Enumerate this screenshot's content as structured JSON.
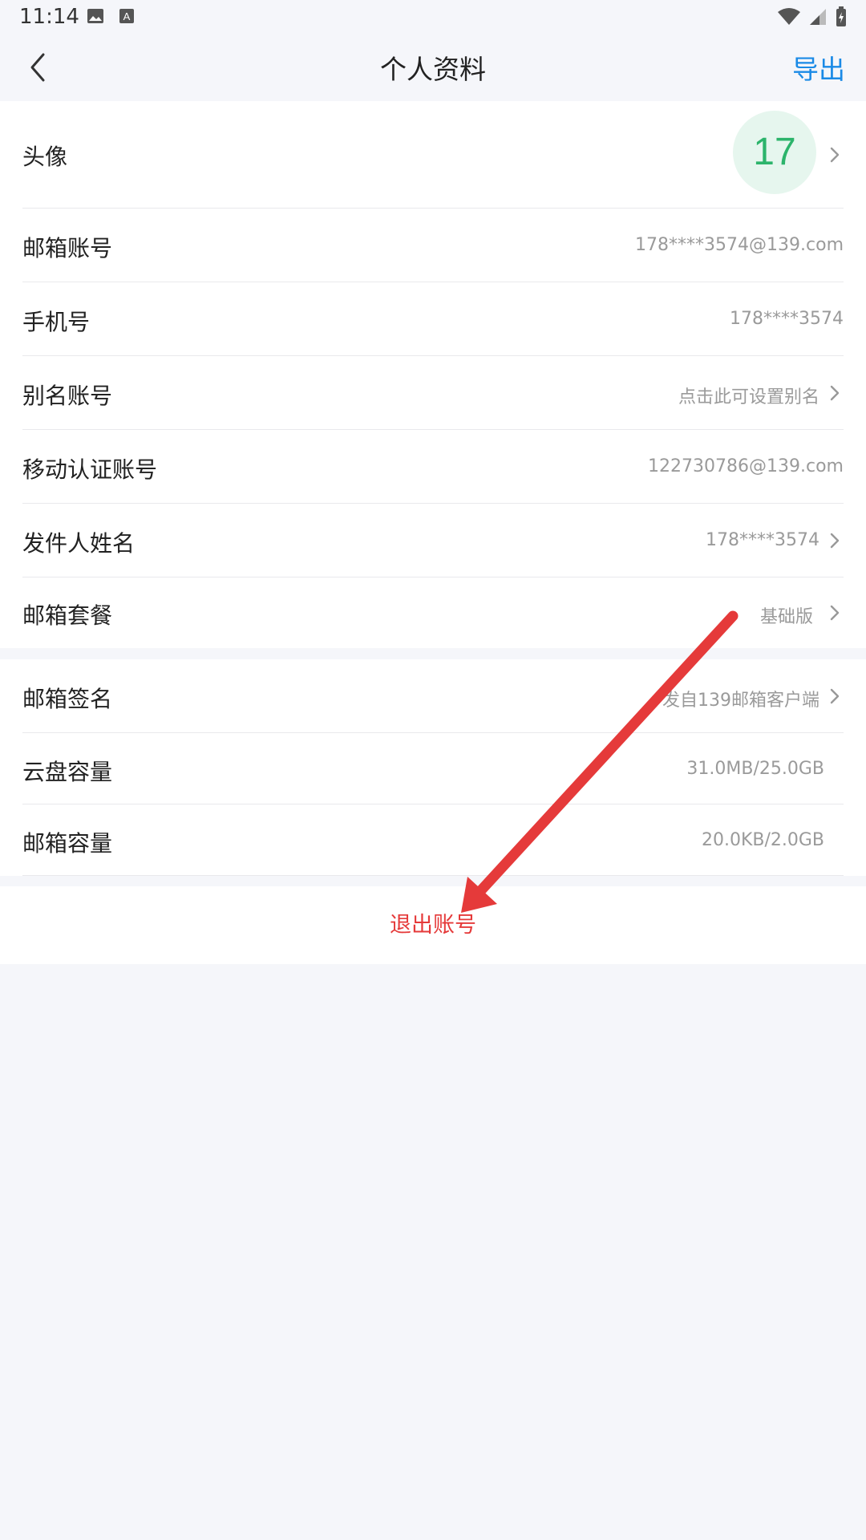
{
  "status_bar": {
    "time": "11:14"
  },
  "header": {
    "title": "个人资料",
    "action_label": "导出"
  },
  "profile": {
    "rows": [
      {
        "label": "头像",
        "avatar_text": "17"
      },
      {
        "label": "邮箱账号",
        "value": "178****3574@139.com"
      },
      {
        "label": "手机号",
        "value": "178****3574"
      },
      {
        "label": "别名账号",
        "value": "点击此可设置别名"
      },
      {
        "label": "移动认证账号",
        "value": "122730786@139.com"
      },
      {
        "label": "发件人姓名",
        "value": "178****3574"
      },
      {
        "label": "邮箱套餐",
        "value": "基础版"
      }
    ]
  },
  "settings": {
    "rows": [
      {
        "label": "邮箱签名",
        "value": "发自139邮箱客户端"
      },
      {
        "label": "云盘容量",
        "value": "31.0MB/25.0GB"
      },
      {
        "label": "邮箱容量",
        "value": "20.0KB/2.0GB"
      }
    ]
  },
  "logout_label": "退出账号",
  "colors": {
    "accent": "#1a8ae6",
    "danger": "#e53a3a",
    "avatar_bg": "#e6f6ee",
    "avatar_fg": "#2cb46b",
    "annotation_arrow": "#e53a3a"
  },
  "icons": [
    "image-icon",
    "text-icon",
    "wifi-icon",
    "signal-icon",
    "battery-icon",
    "back-arrow-icon",
    "chevron-right-icon"
  ]
}
